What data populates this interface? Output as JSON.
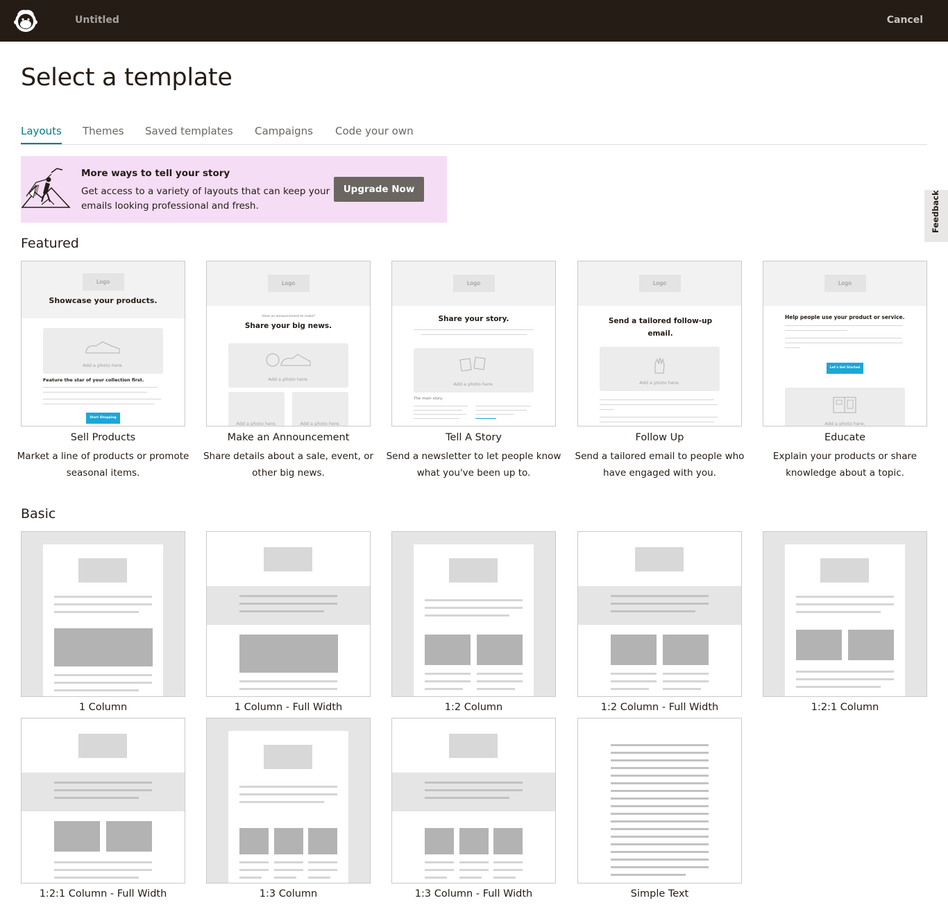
{
  "topbar": {
    "doc_title": "Untitled",
    "cancel_label": "Cancel"
  },
  "page_title": "Select a template",
  "tabs": [
    "Layouts",
    "Themes",
    "Saved templates",
    "Campaigns",
    "Code your own"
  ],
  "promo": {
    "title": "More ways to tell your story",
    "text": "Get access to a variety of layouts that can keep your emails looking professional and fresh.",
    "button": "Upgrade Now"
  },
  "feedback_label": "Feedback",
  "featured": {
    "title": "Featured",
    "cards": [
      {
        "title": "Sell Products",
        "desc": "Market a line of products or promote seasonal items.",
        "preview": {
          "logo": "Logo",
          "heading": "Showcase your products.",
          "photo": "Add a photo here.",
          "subheading": "Feature the star of your collection first.",
          "button": "Start Shopping"
        }
      },
      {
        "title": "Make an Announcement",
        "desc": "Share details about a sale, event, or other big news.",
        "preview": {
          "logo": "Logo",
          "kicker": "Have an announcement to make?",
          "heading": "Share your big news.",
          "photo": "Add a photo here."
        }
      },
      {
        "title": "Tell A Story",
        "desc": "Send a newsletter to let people know what you've been up to.",
        "preview": {
          "logo": "Logo",
          "heading": "Share your story.",
          "photo": "Add a photo here.",
          "kicker": "The main story."
        }
      },
      {
        "title": "Follow Up",
        "desc": "Send a tailored email to people who have engaged with you.",
        "preview": {
          "logo": "Logo",
          "heading": "Send a tailored follow-up email.",
          "photo": "Add a photo here."
        }
      },
      {
        "title": "Educate",
        "desc": "Explain your products or share knowledge about a topic.",
        "preview": {
          "logo": "Logo",
          "heading": "Help people use your product or service.",
          "photo": "Add a photo here.",
          "button": "Let's Get Started"
        }
      }
    ]
  },
  "basic": {
    "title": "Basic",
    "cards": [
      "1 Column",
      "1 Column - Full Width",
      "1:2 Column",
      "1:2 Column - Full Width",
      "1:2:1 Column",
      "1:2:1 Column - Full Width",
      "1:3 Column",
      "1:3 Column - Full Width",
      "Simple Text"
    ]
  },
  "colors": {
    "topbar": "#241c15",
    "accent": "#007c89",
    "promo_bg": "#f6ddf6",
    "button": "#6b6662",
    "cta": "#1ca6d8"
  },
  "icons": [
    "freddie-logo-icon",
    "climber-illustration"
  ]
}
